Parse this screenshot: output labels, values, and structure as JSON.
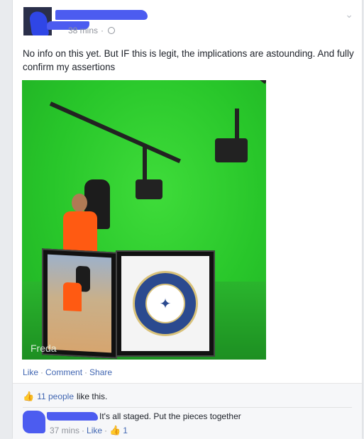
{
  "post": {
    "time": "38 mins",
    "text": "No info on this yet. But IF this is legit, the implications are astounding. And fully confirm my assertions",
    "photo": {
      "watermark": "Freda",
      "seal_text": "CENTRAL INTELLIGENCE AGENCY",
      "background_color": "#2bc72c"
    },
    "actions": {
      "like": "Like",
      "comment": "Comment",
      "share": "Share"
    }
  },
  "likes": {
    "count_label": "11 people",
    "suffix": "like this."
  },
  "comment": {
    "text": "It's all staged. Put the pieces together",
    "time": "37 mins",
    "like": "Like",
    "like_count": "1"
  },
  "colors": {
    "link": "#4267b2",
    "meta": "#90949c",
    "redaction": "#4c5cf0"
  }
}
